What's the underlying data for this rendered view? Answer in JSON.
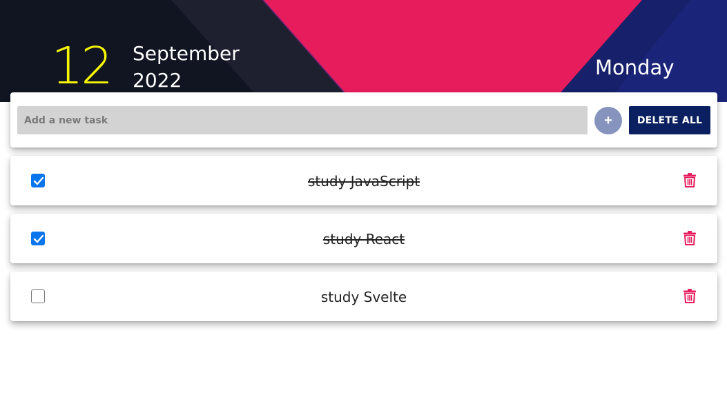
{
  "header": {
    "day": "12",
    "month": "September",
    "year": "2022",
    "weekday": "Monday"
  },
  "add_task": {
    "placeholder": "Add a new task",
    "value": "",
    "add_label": "+",
    "delete_all_label": "DELETE ALL"
  },
  "tasks": [
    {
      "text": "study JavaScript",
      "done": true
    },
    {
      "text": "study React",
      "done": true
    },
    {
      "text": "study Svelte",
      "done": false
    }
  ],
  "colors": {
    "accent_pink": "#e61c5d",
    "navy": "#0b2061",
    "date_yellow": "#f5f500",
    "checkbox_blue": "#0b75ee",
    "trash": "#e61c5d"
  },
  "icons": {
    "trash": "trash-icon",
    "check": "checkmark-icon"
  }
}
